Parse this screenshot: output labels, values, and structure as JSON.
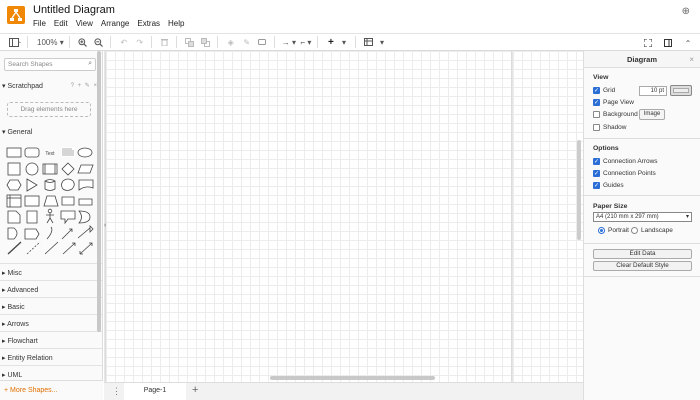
{
  "app": {
    "title": "Untitled Diagram",
    "menu": [
      "File",
      "Edit",
      "View",
      "Arrange",
      "Extras",
      "Help"
    ],
    "accent_color": "#f08705"
  },
  "toolbar": {
    "zoom": "100%",
    "icons": [
      "sidebar-toggle-icon",
      "zoom-in-icon",
      "zoom-out-icon",
      "undo-icon",
      "redo-icon",
      "delete-icon",
      "to-front-icon",
      "to-back-icon",
      "fill-color-icon",
      "line-color-icon",
      "shadow-icon",
      "connection-icon",
      "waypoints-icon",
      "insert-icon",
      "table-icon",
      "fullscreen-icon",
      "format-panel-icon",
      "collapse-icon"
    ]
  },
  "sidebar": {
    "search_placeholder": "Search Shapes",
    "scratchpad_label": "Scratchpad",
    "scratchpad_tools": "? + ✎ ×",
    "dropzone_text": "Drag elements here",
    "general_label": "General",
    "text_shape_label": "Text",
    "sections": [
      "Misc",
      "Advanced",
      "Basic",
      "Arrows",
      "Flowchart",
      "Entity Relation",
      "UML"
    ],
    "more_shapes": "More Shapes..."
  },
  "pages": {
    "tabs": [
      "Page-1"
    ],
    "add_label": "+"
  },
  "format_panel": {
    "header": "Diagram",
    "view_title": "View",
    "grid_label": "Grid",
    "grid_size": "10 pt",
    "page_view_label": "Page View",
    "background_label": "Background",
    "image_button": "Image",
    "shadow_label": "Shadow",
    "options_title": "Options",
    "connection_arrows": "Connection Arrows",
    "connection_points": "Connection Points",
    "guides": "Guides",
    "paper_size_title": "Paper Size",
    "paper_size_value": "A4 (210 mm x 297 mm)",
    "portrait": "Portrait",
    "landscape": "Landscape",
    "edit_data": "Edit Data",
    "clear_default_style": "Clear Default Style",
    "checked_color": "#2b6fd6"
  }
}
